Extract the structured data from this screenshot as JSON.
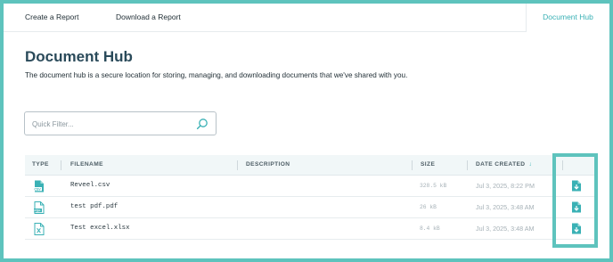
{
  "topnav": {
    "create_report": "Create a Report",
    "download_report": "Download a Report",
    "document_hub": "Document Hub"
  },
  "page": {
    "title": "Document Hub",
    "description": "The document hub is a secure location for storing, managing, and downloading documents that we've shared with you."
  },
  "filter": {
    "placeholder": "Quick Filter...",
    "value": ""
  },
  "table": {
    "columns": {
      "type": "TYPE",
      "filename": "FILENAME",
      "description": "DESCRIPTION",
      "size": "SIZE",
      "date_created": "DATE CREATED"
    },
    "sort_indicator": "↓",
    "rows": [
      {
        "type_icon": "csv-file-icon",
        "type_label": "CSV",
        "filename": "Reveel.csv",
        "description": "",
        "size": "328.5 kB",
        "date_created": "Jul 3, 2025, 8:22 PM"
      },
      {
        "type_icon": "pdf-file-icon",
        "type_label": "PDF",
        "filename": "test pdf.pdf",
        "description": "",
        "size": "26 kB",
        "date_created": "Jul 3, 2025, 3:48 AM"
      },
      {
        "type_icon": "excel-file-icon",
        "type_label": "",
        "filename": "Test excel.xlsx",
        "description": "",
        "size": "8.4 kB",
        "date_created": "Jul 3, 2025, 3:48 AM"
      }
    ]
  },
  "colors": {
    "accent": "#3ab1b5",
    "highlight": "#5ec3bd",
    "title": "#2a4a5a",
    "header_bg": "#f1f7f8"
  }
}
